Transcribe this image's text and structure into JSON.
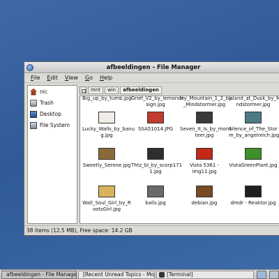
{
  "window": {
    "title": "afbeeldingen - File Manager",
    "menu": [
      {
        "ul": "F",
        "rest": "ile"
      },
      {
        "ul": "E",
        "rest": "dit"
      },
      {
        "ul": "V",
        "rest": "iew"
      },
      {
        "ul": "G",
        "rest": "o"
      },
      {
        "ul": "H",
        "rest": "elp"
      }
    ]
  },
  "sidebar": {
    "items": [
      {
        "label": "nic",
        "icon": "home-icon"
      },
      {
        "label": "Trash",
        "icon": "trash-icon"
      },
      {
        "label": "Desktop",
        "icon": "desktop-icon"
      },
      {
        "label": "File System",
        "icon": "harddisk-icon"
      }
    ]
  },
  "pathbar": {
    "crumbs": [
      "mnt",
      "win",
      "afbeeldingen"
    ]
  },
  "files": {
    "top_row": [
      "Big_up_by_tumb.jpg",
      "Grief_V2_by_lemonde\nsign.jpg",
      "Icy_Mountain_1_2_by\n_Mindstormer.jpg",
      "Island_at_Dusk_by_Mi\nndstormer.jpg"
    ],
    "rows": [
      [
        {
          "name": "Lucky_Walls_by_banu\ng.jpg",
          "color": "#f0ece6"
        },
        {
          "name": "SSA51014.JPG",
          "color": "#c33b2f"
        },
        {
          "name": "Seven_It_Is_by_mons\nteer.jpg",
          "color": "#3a3a3a"
        },
        {
          "name": "Silence_of_The_Stor\nm_by_angelreich.jpg",
          "color": "#4c7a82"
        }
      ],
      [
        {
          "name": "Sweetly_Serene.jpg",
          "color": "#8a6a3b"
        },
        {
          "name": "Thtz_bl_by_scorp171\n1.jpg",
          "color": "#2e2e2e"
        },
        {
          "name": "Vista 5361 - img11.jpg",
          "color": "#c12a18"
        },
        {
          "name": "VistaGreenPlant.jpg",
          "color": "#3f8f2a"
        }
      ],
      [
        {
          "name": "Wall_Soul_Girl_by_R\nootsGirl.jpg",
          "color": "#d9b35a"
        },
        {
          "name": "balls.jpg",
          "color": "#6a6a6a"
        },
        {
          "name": "debian.jpg",
          "color": "#7a4a22"
        },
        {
          "name": "dmdr - Reaktor.jpg",
          "color": "#1f1f1f"
        }
      ]
    ]
  },
  "status": "38 items (12.5 MB), Free space: 14.2 GB",
  "taskbar": {
    "tasks": [
      {
        "label": "afbeeldingen - File Manager",
        "active": true
      },
      {
        "label": "[Recent Unread Topics - Mo...",
        "active": false
      },
      {
        "label": "[Terminal]",
        "active": false
      }
    ]
  }
}
